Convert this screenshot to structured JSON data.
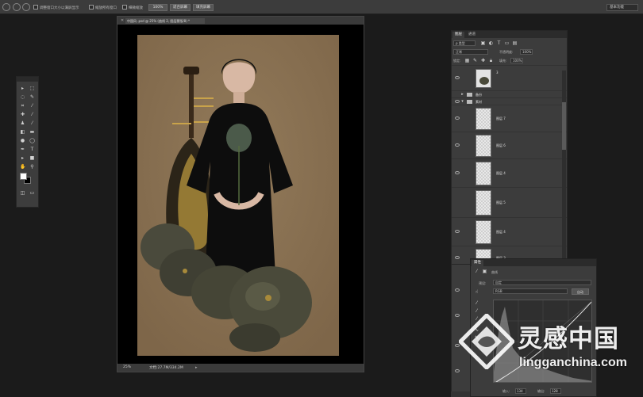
{
  "options_bar": {
    "checkbox_1_label": "调整窗口大小以满屏显示",
    "checkbox_2_label": "缩放所有窗口",
    "checkbox_3_label": "细微缩放",
    "btn_100": "100%",
    "btn_fit": "适合屏幕",
    "btn_fill": "填充屏幕",
    "workspace": "基本功能"
  },
  "document": {
    "tab_title": "中国风 .psd @ 25% (曲线 2, 图层蒙版/8) *",
    "zoom": "25%",
    "doc_info": "文档:27.7M/334.2M"
  },
  "layers_panel": {
    "tab_layers": "图层",
    "tab_channels": "通道",
    "filter_kind": "ρ 类型",
    "blend_mode": "正常",
    "opacity_label": "不透明度:",
    "opacity_value": "100%",
    "lock_label": "锁定:",
    "fill_label": "填充:",
    "fill_value": "100%",
    "top_layer_name": "3",
    "groups": [
      "备份",
      "素材"
    ],
    "layers": [
      "图层 7",
      "图层 6",
      "图层 4",
      "图层 5",
      "图层 4",
      "图层 3"
    ]
  },
  "properties_panel": {
    "tab": "属性",
    "title": "曲线",
    "preset_label": "预设:",
    "preset_value": "自定",
    "channel_value": "RGB",
    "auto_button": "自动",
    "input_label": "输入:",
    "input_value": "134",
    "output_label": "输出:",
    "output_value": "128"
  },
  "watermark": {
    "text": "灵感中国",
    "url": "lingganchina.com"
  },
  "colors": {
    "canvas_bg": "#8a7254",
    "panel_bg": "#3c3c3c",
    "app_bg": "#1b1b1b"
  }
}
